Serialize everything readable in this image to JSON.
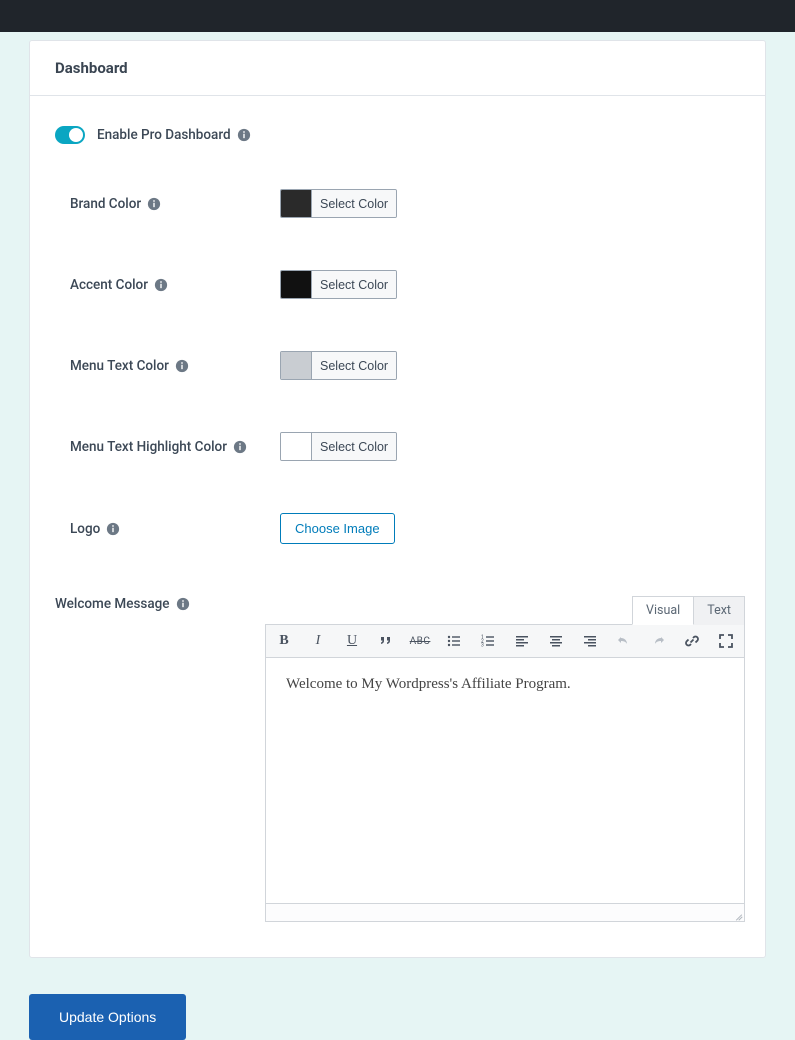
{
  "panel": {
    "title": "Dashboard"
  },
  "enable_toggle": {
    "label": "Enable Pro Dashboard"
  },
  "fields": {
    "brand_color": {
      "label": "Brand Color",
      "button": "Select Color"
    },
    "accent_color": {
      "label": "Accent Color",
      "button": "Select Color"
    },
    "menu_text_color": {
      "label": "Menu Text Color",
      "button": "Select Color"
    },
    "menu_text_highlight": {
      "label": "Menu Text Highlight Color",
      "button": "Select Color"
    },
    "logo": {
      "label": "Logo",
      "button": "Choose Image"
    },
    "welcome_message": {
      "label": "Welcome Message"
    }
  },
  "editor": {
    "tabs": {
      "visual": "Visual",
      "text": "Text"
    },
    "content": "Welcome to My Wordpress's Affiliate Program."
  },
  "submit": {
    "label": "Update Options"
  }
}
